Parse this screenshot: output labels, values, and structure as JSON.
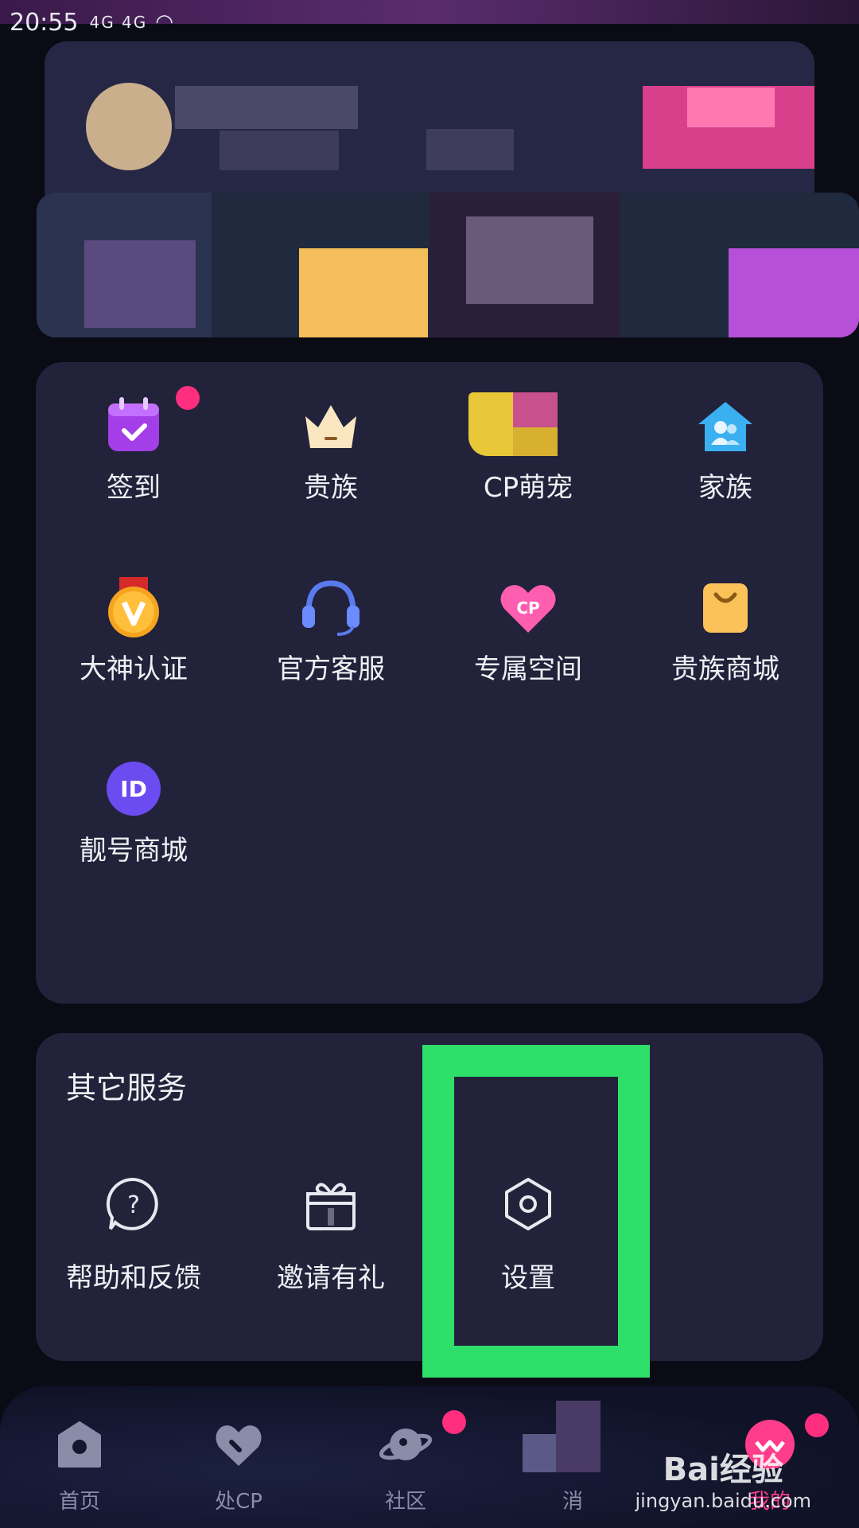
{
  "status_bar": {
    "time": "20:55",
    "signal": "4G 4G"
  },
  "menu_grid": {
    "items": [
      {
        "label": "签到",
        "icon": "calendar-check-icon",
        "badge": true
      },
      {
        "label": "贵族",
        "icon": "crown-icon",
        "badge": false
      },
      {
        "label": "CP萌宠",
        "icon": "pet-icon",
        "badge": false
      },
      {
        "label": "家族",
        "icon": "family-house-icon",
        "badge": false
      },
      {
        "label": "大神认证",
        "icon": "v-medal-icon",
        "badge": false
      },
      {
        "label": "官方客服",
        "icon": "headset-icon",
        "badge": false
      },
      {
        "label": "专属空间",
        "icon": "cp-heart-icon",
        "badge": false
      },
      {
        "label": "贵族商城",
        "icon": "shopping-bag-icon",
        "badge": false
      },
      {
        "label": "靓号商城",
        "icon": "id-badge-icon",
        "badge": false
      }
    ]
  },
  "other_services": {
    "title": "其它服务",
    "items": [
      {
        "label": "帮助和反馈",
        "icon": "help-bubble-icon"
      },
      {
        "label": "邀请有礼",
        "icon": "gift-icon"
      },
      {
        "label": "设置",
        "icon": "settings-hex-icon"
      }
    ]
  },
  "bottom_nav": {
    "items": [
      {
        "label": "首页",
        "icon": "home-icon",
        "badge": false,
        "active": false
      },
      {
        "label": "处CP",
        "icon": "heart-icon",
        "badge": false,
        "active": false
      },
      {
        "label": "社区",
        "icon": "planet-icon",
        "badge": true,
        "active": false
      },
      {
        "label": "消",
        "icon": "message-icon",
        "badge": false,
        "active": false
      },
      {
        "label": "我的",
        "icon": "profile-face-icon",
        "badge": true,
        "active": true
      }
    ]
  },
  "watermark": {
    "line1": "Bai经验",
    "line2": "jingyan.baidu.com"
  },
  "colors": {
    "card_bg": "#22223a",
    "accent_pink": "#ff2e7e",
    "highlight_green": "#2ee06a",
    "nav_inactive": "#8a8ca8"
  }
}
